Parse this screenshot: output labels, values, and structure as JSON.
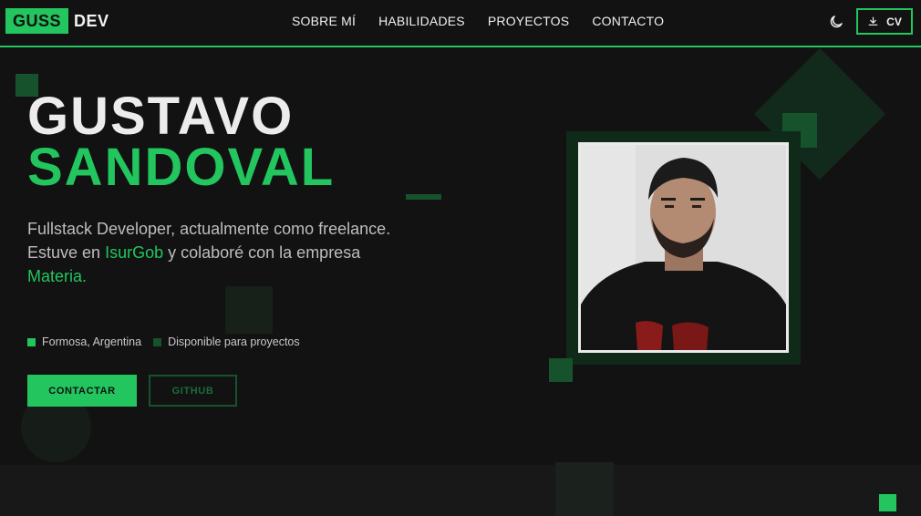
{
  "nav": {
    "logo_primary": "GUSS",
    "logo_secondary": "DEV",
    "links": [
      "SOBRE MÍ",
      "HABILIDADES",
      "PROYECTOS",
      "CONTACTO"
    ],
    "cv_label": "CV"
  },
  "hero": {
    "first_name": "GUSTAVO",
    "last_name": "SANDOVAL",
    "desc_line1": "Fullstack Developer, actualmente como freelance.",
    "desc_part1": "Estuve en ",
    "company1": "IsurGob",
    "desc_part2": " y colaboré con la empresa ",
    "company2": "Materia",
    "desc_end": ".",
    "location": "Formosa, Argentina",
    "availability": "Disponible para proyectos",
    "contact_button": "CONTACTAR",
    "github_button": "GITHUB"
  },
  "colors": {
    "accent": "#22c55e",
    "background": "#121212",
    "dark_green": "#16532c"
  },
  "icons": [
    "moon-icon",
    "download-icon"
  ]
}
